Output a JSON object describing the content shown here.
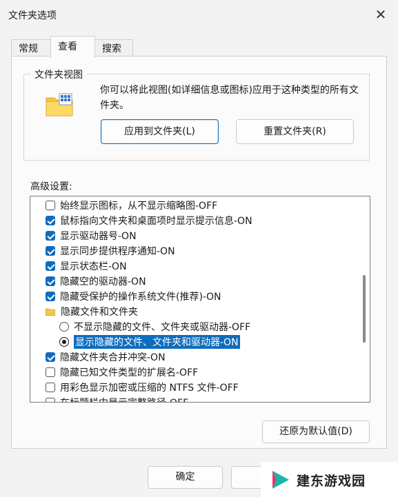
{
  "window": {
    "title": "文件夹选项"
  },
  "tabs": [
    {
      "label": "常规"
    },
    {
      "label": "查看"
    },
    {
      "label": "搜索"
    }
  ],
  "folder_views": {
    "legend": "文件夹视图",
    "description": "你可以将此视图(如详细信息或图标)应用于这种类型的所有文件夹。",
    "apply_button": "应用到文件夹(L)",
    "reset_button": "重置文件夹(R)"
  },
  "advanced": {
    "label": "高级设置:",
    "items": [
      {
        "type": "checkbox",
        "checked": false,
        "label": "始终显示图标，从不显示缩略图-OFF"
      },
      {
        "type": "checkbox",
        "checked": true,
        "label": "鼠标指向文件夹和桌面项时显示提示信息-ON"
      },
      {
        "type": "checkbox",
        "checked": true,
        "label": "显示驱动器号-ON"
      },
      {
        "type": "checkbox",
        "checked": true,
        "label": "显示同步提供程序通知-ON"
      },
      {
        "type": "checkbox",
        "checked": true,
        "label": "显示状态栏-ON"
      },
      {
        "type": "checkbox",
        "checked": true,
        "label": "隐藏空的驱动器-ON"
      },
      {
        "type": "checkbox",
        "checked": true,
        "label": "隐藏受保护的操作系统文件(推荐)-ON"
      },
      {
        "type": "folder",
        "label": "隐藏文件和文件夹"
      },
      {
        "type": "radio",
        "checked": false,
        "label": "不显示隐藏的文件、文件夹或驱动器-OFF"
      },
      {
        "type": "radio",
        "checked": true,
        "label": "显示隐藏的文件、文件夹和驱动器-ON"
      },
      {
        "type": "checkbox",
        "checked": true,
        "label": "隐藏文件夹合并冲突-ON"
      },
      {
        "type": "checkbox",
        "checked": false,
        "label": "隐藏已知文件类型的扩展名-OFF"
      },
      {
        "type": "checkbox",
        "checked": false,
        "label": "用彩色显示加密或压缩的 NTFS 文件-OFF"
      },
      {
        "type": "checkbox",
        "checked": false,
        "label": "在标题栏中显示完整路径-OFF"
      }
    ]
  },
  "restore_defaults_button": "还原为默认值(D)",
  "ok_button": "确定",
  "watermark": {
    "text": "建东游戏园"
  },
  "colors": {
    "accent": "#0f6cbd",
    "background": "#f3f3f3"
  }
}
